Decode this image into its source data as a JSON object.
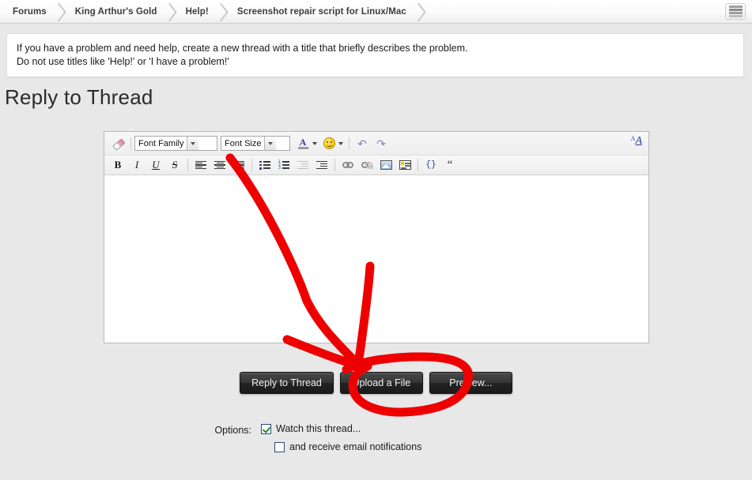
{
  "breadcrumb": {
    "items": [
      {
        "label": "Forums"
      },
      {
        "label": "King Arthur's Gold"
      },
      {
        "label": "Help!"
      },
      {
        "label": "Screenshot repair script for Linux/Mac"
      }
    ],
    "menu_icon": "list-menu-icon"
  },
  "notice": {
    "line1": "If you have a problem and need help, create a new thread with a title that briefly describes the problem.",
    "line2": "Do not use titles like 'Help!' or 'I have a problem!'"
  },
  "page": {
    "title": "Reply to Thread"
  },
  "editor": {
    "toolbar_row1": {
      "eraser": {
        "name": "remove-formatting-icon",
        "title": "Remove Formatting"
      },
      "font_family": {
        "label": "Font Family"
      },
      "font_size": {
        "label": "Font Size"
      },
      "font_color": {
        "name": "font-color-icon",
        "glyph": "A"
      },
      "smiley": {
        "name": "smiley-icon"
      },
      "undo": {
        "name": "undo-icon",
        "glyph": "↶"
      },
      "redo": {
        "name": "redo-icon",
        "glyph": "↷"
      },
      "toggle_editor": {
        "name": "toggle-bbcode-icon",
        "small": "A",
        "big": "A"
      }
    },
    "toolbar_row2": {
      "bold": "B",
      "italic": "I",
      "underline": "U",
      "strikethrough": "S",
      "align_left": "align-left-icon",
      "align_center": "align-center-icon",
      "align_right": "align-right-icon",
      "bullet_list": "bullet-list-icon",
      "numbered_list": "numbered-list-icon",
      "outdent": "outdent-icon",
      "indent": "indent-icon",
      "link": "insert-link-icon",
      "unlink": "remove-link-icon",
      "image": "insert-image-icon",
      "media": "insert-media-icon",
      "code": "{}",
      "quote": "“"
    },
    "body_text": ""
  },
  "buttons": [
    {
      "label": "Reply to Thread",
      "name": "reply-to-thread-button"
    },
    {
      "label": "Upload a File",
      "name": "upload-a-file-button"
    },
    {
      "label": "Preview...",
      "name": "preview-button"
    }
  ],
  "options": {
    "label": "Options:",
    "items": [
      {
        "label": "Watch this thread...",
        "checked": true
      },
      {
        "label": "and receive email notifications",
        "checked": false
      }
    ]
  },
  "annotation": {
    "color": "#ee0000",
    "description": "hand-drawn red arrow pointing to the Upload a File button, with an oval circling it"
  }
}
